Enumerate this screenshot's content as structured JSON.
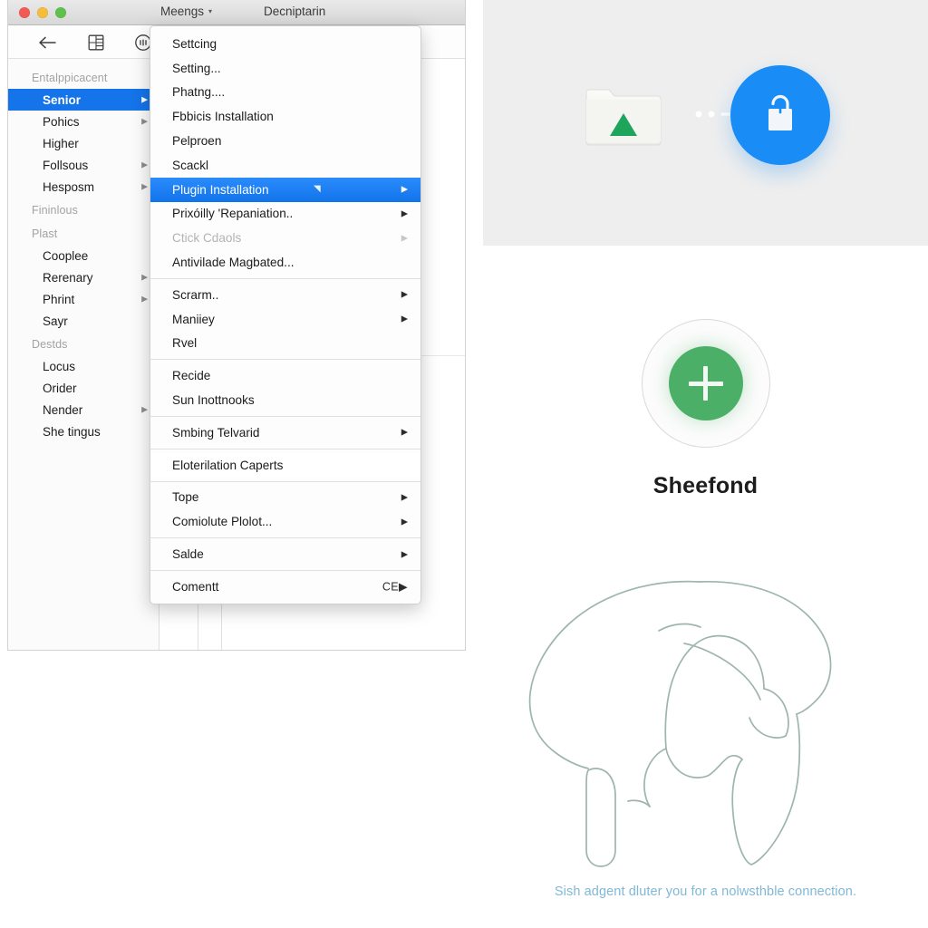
{
  "window": {
    "traffic_lights": [
      "close",
      "minimize",
      "zoom"
    ],
    "menu_title": "Meengs",
    "menu_caret": "▾",
    "secondary_title": "Decniptarin",
    "toolbar_icons": [
      "back-arrow-icon",
      "layout-grid-icon",
      "clock-circle-icon"
    ]
  },
  "sidebar": {
    "groups": [
      {
        "label": "Entalppicacent",
        "items": [
          {
            "label": "Senior",
            "arrow": "▶",
            "selected": true
          },
          {
            "label": "Pohics",
            "arrow": "▶",
            "selected": false
          },
          {
            "label": "Higher",
            "arrow": "",
            "selected": false
          },
          {
            "label": "Follsous",
            "arrow": "▶",
            "selected": false
          },
          {
            "label": "Hesposm",
            "arrow": "▶",
            "selected": false
          }
        ]
      },
      {
        "label": "Fininlous",
        "items": []
      },
      {
        "label": "Plast",
        "items": [
          {
            "label": "Cooplee",
            "arrow": "",
            "selected": false
          },
          {
            "label": "Rerenary",
            "arrow": "▶",
            "selected": false
          },
          {
            "label": "Phrint",
            "arrow": "▶",
            "selected": false
          },
          {
            "label": "Sayr",
            "arrow": "",
            "selected": false
          }
        ]
      },
      {
        "label": "Destds",
        "items": [
          {
            "label": "Locus",
            "arrow": "",
            "selected": false
          },
          {
            "label": "Orider",
            "arrow": "",
            "selected": false
          },
          {
            "label": "Nender",
            "arrow": "▶",
            "selected": false
          },
          {
            "label": "She tingus",
            "arrow": "",
            "selected": false
          }
        ]
      }
    ]
  },
  "dropdown_menu": {
    "sections": [
      {
        "items": [
          {
            "label": "Settcing",
            "arrow": "",
            "shortcut": "",
            "state": "normal"
          },
          {
            "label": "Setting...",
            "arrow": "",
            "shortcut": "",
            "state": "normal"
          },
          {
            "label": "Phatng....",
            "arrow": "",
            "shortcut": "",
            "state": "normal"
          },
          {
            "label": "Fbbicis Installation",
            "arrow": "",
            "shortcut": "",
            "state": "normal"
          },
          {
            "label": "Pelproen",
            "arrow": "",
            "shortcut": "",
            "state": "normal"
          },
          {
            "label": "Scackl",
            "arrow": "",
            "shortcut": "",
            "state": "normal"
          },
          {
            "label": "Plugin Installation",
            "arrow": "▶",
            "shortcut": "",
            "state": "highlighted",
            "badge": "◥"
          },
          {
            "label": "Prixóilly 'Repaniation..",
            "arrow": "▶",
            "shortcut": "",
            "state": "normal"
          },
          {
            "label": "Ctick Cdaols",
            "arrow": "▶",
            "shortcut": "",
            "state": "disabled"
          },
          {
            "label": "Antivilade Magbated...",
            "arrow": "",
            "shortcut": "",
            "state": "normal"
          }
        ]
      },
      {
        "items": [
          {
            "label": "Scrarm..",
            "arrow": "▶",
            "shortcut": "",
            "state": "normal"
          },
          {
            "label": "Maniiey",
            "arrow": "▶",
            "shortcut": "",
            "state": "normal"
          },
          {
            "label": "Rvel",
            "arrow": "",
            "shortcut": "",
            "state": "normal"
          }
        ]
      },
      {
        "items": [
          {
            "label": "Recide",
            "arrow": "",
            "shortcut": "",
            "state": "normal"
          },
          {
            "label": "Sun Inottnooks",
            "arrow": "",
            "shortcut": "",
            "state": "normal"
          }
        ]
      },
      {
        "items": [
          {
            "label": "Smbing Telvarid",
            "arrow": "▶",
            "shortcut": "",
            "state": "normal"
          }
        ]
      },
      {
        "items": [
          {
            "label": "Eloterilation Caperts",
            "arrow": "",
            "shortcut": "",
            "state": "card"
          }
        ]
      },
      {
        "items": [
          {
            "label": "Tope",
            "arrow": "▶",
            "shortcut": "",
            "state": "normal"
          },
          {
            "label": "Comiolute Plolot...",
            "arrow": "▶",
            "shortcut": "",
            "state": "normal"
          }
        ]
      },
      {
        "items": [
          {
            "label": "Salde",
            "arrow": "▶",
            "shortcut": "",
            "state": "normal"
          }
        ]
      },
      {
        "items": [
          {
            "label": "Comentt",
            "arrow": "▶",
            "shortcut": "CE",
            "state": "normal"
          }
        ]
      }
    ]
  },
  "right_panel": {
    "transfer_illustration": {
      "source_icon": "folder-with-green-triangle-icon",
      "connector_icon": "dotted-arrow-icon",
      "destination_icon": "shopping-bag-in-blue-circle-icon",
      "background_color": "#eeeeee",
      "accent_blue": "#1a8cf5",
      "accent_green": "#1fa45c"
    },
    "add_block": {
      "icon": "plus-in-green-circle-icon",
      "label": "Sheefond",
      "accent_green": "#4caf68"
    },
    "brain_illustration": {
      "icon": "brain-outline-illustration",
      "stroke_color": "#9db5ac"
    },
    "caption": "Sish adgent dluter you for a nolwsthble connection.",
    "caption_color": "#7fb9d6"
  }
}
